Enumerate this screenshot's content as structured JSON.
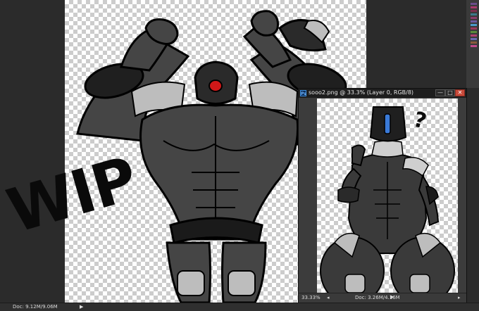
{
  "main": {
    "doc_size": "Doc: 9.12M/9.06M",
    "status_arrow": "▶",
    "overlay_text": "WIP"
  },
  "doc_window": {
    "title": "sooo2.png @ 33.3% (Layer 0, RGB/8)",
    "ps_icon": "Ps",
    "buttons": {
      "minimize": "—",
      "maximize": "□",
      "close": "✕"
    },
    "status": {
      "zoom": "33.33%",
      "doc_size": "Doc: 3.26M/4.16M",
      "arrow": "▶",
      "scroll_left": "◂",
      "scroll_right": "▸"
    }
  },
  "annotation": "?",
  "swatch_colors": [
    "#6b4d8a",
    "#a83a6c",
    "#7b2f4c",
    "#3c7a8a",
    "#8a3c6b",
    "#6c5aa0",
    "#4a9ac8",
    "#9a3a5c",
    "#5a8a3a",
    "#b04070",
    "#6a6ab0",
    "#8a5a3a",
    "#c04a8a"
  ]
}
